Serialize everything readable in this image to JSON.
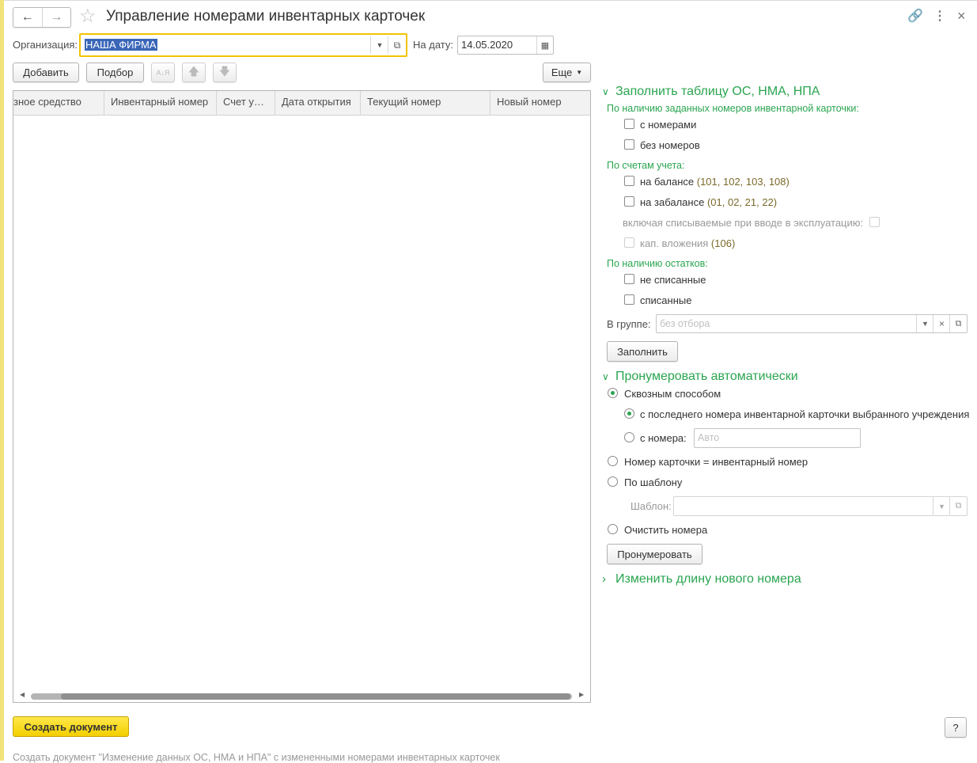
{
  "window": {
    "title": "Управление номерами инвентарных карточек",
    "back_icon": "←",
    "forward_icon": "→",
    "star_icon": "☆",
    "link_icon": "🔗",
    "more_icon": "⋮",
    "close_icon": "×"
  },
  "header": {
    "org_label": "Организация:",
    "org_value": "НАША ФИРМА",
    "date_label": "На дату:",
    "date_value": "14.05.2020"
  },
  "toolbar": {
    "add_label": "Добавить",
    "pick_label": "Подбор",
    "sort_icon": "A↓Я",
    "up_icon": "🡅",
    "down_icon": "🡇",
    "more_label": "Еще"
  },
  "table": {
    "columns": [
      "зное средство",
      "Инвентарный номер",
      "Счет у…",
      "Дата открытия",
      "Текущий номер",
      "Новый номер"
    ]
  },
  "fill_section": {
    "title": "Заполнить таблицу ОС, НМА, НПА",
    "by_numbers_label": "По наличию заданных номеров инвентарной карточки:",
    "with_numbers": "с номерами",
    "without_numbers": "без номеров",
    "by_accounts_label": "По счетам учета:",
    "on_balance": "на балансе",
    "on_balance_accounts": "(101, 102, 103, 108)",
    "off_balance": "на забалансе",
    "off_balance_accounts": "(01, 02, 21, 22)",
    "including_written_off": "включая списываемые при вводе в эксплуатацию:",
    "capital_investments": "кап. вложения",
    "capital_investments_account": "(106)",
    "by_balances_label": "По наличию остатков:",
    "not_written_off": "не списанные",
    "written_off": "списанные",
    "group_label": "В группе:",
    "group_placeholder": "без отбора",
    "fill_button": "Заполнить"
  },
  "auto_section": {
    "title": "Пронумеровать автоматически",
    "through_method": "Сквозным способом",
    "from_last_number": "с последнего номера инвентарной карточки выбранного учреждения",
    "from_number": "с номера:",
    "from_number_placeholder": "Авто",
    "card_eq_inventory": "Номер карточки = инвентарный номер",
    "by_template": "По шаблону",
    "template_label": "Шаблон:",
    "clear_numbers": "Очистить номера",
    "number_button": "Пронумеровать"
  },
  "length_section": {
    "title": "Изменить длину нового номера"
  },
  "footer": {
    "create_button": "Создать документ",
    "help_label": "?",
    "note": "Создать документ \"Изменение данных ОС, НМА и НПА\" с измененными номерами инвентарных карточек"
  }
}
